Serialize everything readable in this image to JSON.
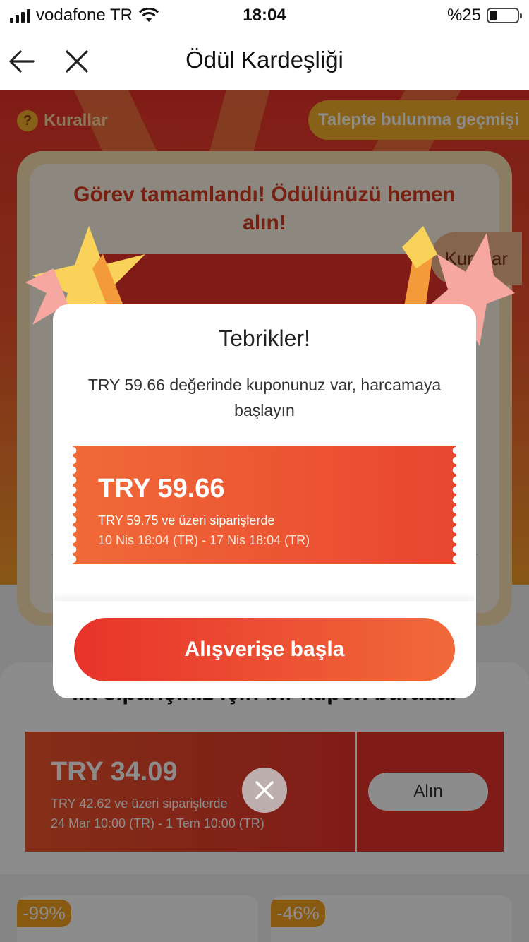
{
  "status_bar": {
    "carrier": "vodafone TR",
    "time": "18:04",
    "battery": "%25"
  },
  "nav": {
    "title": "Ödül Kardeşliği"
  },
  "page": {
    "rules_label": "Kurallar",
    "history_label": "Talepte bulunma geçmişi",
    "task_title": "Görev tamamlandı! Ödülünüzü hemen alın!",
    "rules_tag": "Kurallar",
    "first_order_title": "İlk siparişiniz için bir kupon burada!",
    "bg_coupon": {
      "amount": "TRY 34.09",
      "condition": "TRY 42.62 ve üzeri siparişlerde",
      "dates": "24 Mar 10:00 (TR) - 1 Tem 10:00 (TR)",
      "button": "Alın"
    },
    "products": [
      {
        "discount": "-99%"
      },
      {
        "discount": "-46%"
      }
    ]
  },
  "modal": {
    "title": "Tebrikler!",
    "message": "TRY 59.66 değerinde kuponunuz var, harcamaya başlayın",
    "coupon": {
      "amount": "TRY 59.66",
      "condition": "TRY 59.75 ve üzeri siparişlerde",
      "dates": "10 Nis 18:04 (TR) - 17 Nis 18:04 (TR)"
    },
    "button": "Alışverişe başla"
  },
  "colors": {
    "accent": "#e8332b",
    "accent_light": "#f06a3a",
    "gold": "#f6b12b"
  }
}
